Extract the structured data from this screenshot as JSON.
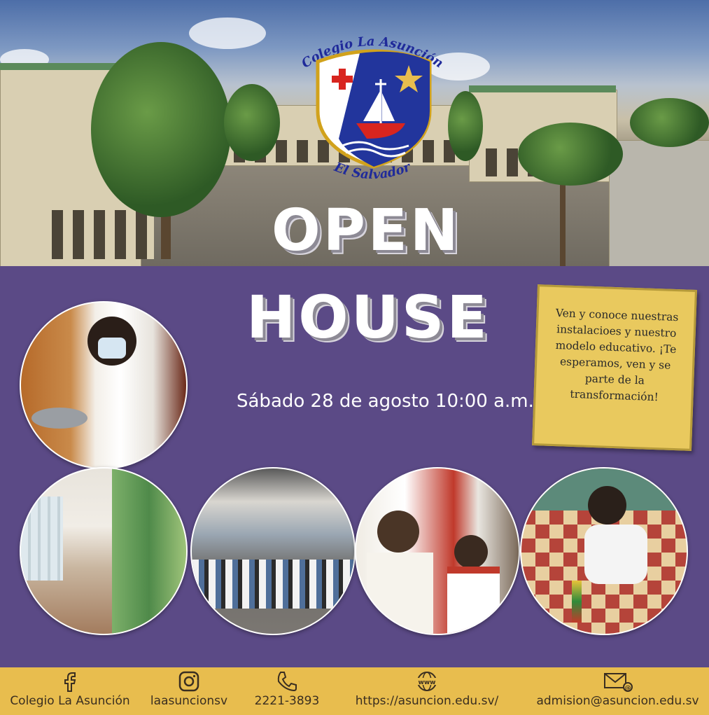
{
  "crest": {
    "top_text": "Colegio La Asunción",
    "bottom_text": "El Salvador"
  },
  "headline": {
    "line1": "OPEN",
    "line2": "HOUSE"
  },
  "event_date": "Sábado 28 de agosto 10:00 a.m.",
  "note": {
    "text": "Ven y conoce nuestras instalacioes y nuestro modelo educativo. ¡Te esperamos, ven y se parte de la transformación!"
  },
  "footer": {
    "items": [
      {
        "icon": "facebook-icon",
        "label": "Colegio La Asunción"
      },
      {
        "icon": "instagram-icon",
        "label": "laasuncionsv"
      },
      {
        "icon": "phone-icon",
        "label": "2221-3893"
      },
      {
        "icon": "www-icon",
        "label": "https://asuncion.edu.sv/"
      },
      {
        "icon": "mail-icon",
        "label": "admision@asuncion.edu.sv"
      }
    ]
  },
  "colors": {
    "background": "#5b4a86",
    "footer": "#e8bd4e",
    "note": "#e9c95e",
    "crest_blue": "#1f2a9a",
    "crest_red": "#d8251f"
  }
}
